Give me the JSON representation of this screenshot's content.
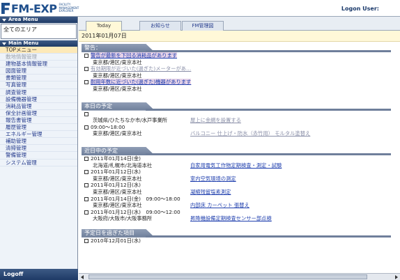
{
  "app": {
    "logo_text": "FM-EXP",
    "logo_sub": "FACILITY MANAGEMENT EXPLORER",
    "logon_label": "Logon User:"
  },
  "sidebar": {
    "area_menu_title": "Area Menu",
    "area_value": "全てのエリア",
    "main_menu_title": "Main Menu",
    "items": [
      {
        "label": "TOPメニュー",
        "state": "active"
      },
      {
        "label": "敷地情報管理",
        "state": "disabled"
      },
      {
        "label": "建物基本情報管理",
        "state": "normal"
      },
      {
        "label": "図面管理",
        "state": "normal"
      },
      {
        "label": "書類管理",
        "state": "normal"
      },
      {
        "label": "写真管理",
        "state": "normal"
      },
      {
        "label": "調査管理",
        "state": "normal"
      },
      {
        "label": "設備機器管理",
        "state": "normal"
      },
      {
        "label": "消耗品管理",
        "state": "normal"
      },
      {
        "label": "保全計画管理",
        "state": "normal"
      },
      {
        "label": "報告書管理",
        "state": "normal"
      },
      {
        "label": "履歴管理",
        "state": "normal"
      },
      {
        "label": "エネルギー管理",
        "state": "normal"
      },
      {
        "label": "補助管理",
        "state": "normal"
      },
      {
        "label": "清掃管理",
        "state": "normal"
      },
      {
        "label": "警備管理",
        "state": "normal"
      },
      {
        "label": "システム管理",
        "state": "normal"
      }
    ],
    "logoff_label": "Logoff"
  },
  "tabs": [
    {
      "label": "Today"
    },
    {
      "label": "お知らせ"
    },
    {
      "label": "FM管理図"
    }
  ],
  "date": "2011年01月07日",
  "sections": {
    "warning": {
      "title": "警告：",
      "rows": [
        {
          "text": "警告が最新を下回る消耗品があります",
          "style": "hl-link",
          "icon": true
        },
        {
          "text": "東京都/港区/東京本社",
          "style": "plain"
        },
        {
          "text": "有効期限が近づいた(過ぎた)メーターがあ…",
          "style": "muted-link",
          "icon": true
        },
        {
          "text": "東京都/港区/東京本社",
          "style": "plain"
        },
        {
          "text": "耐用年数に近づいた(過ぎた)機器があります",
          "style": "hl-link",
          "icon": true
        },
        {
          "text": "東京都/港区/東京本社",
          "style": "plain"
        }
      ]
    },
    "today": {
      "title": "本日の予定",
      "rows": [
        {
          "left": "",
          "right": ""
        },
        {
          "left": "茨城県/ひたちなか市/水戸事業所",
          "right": "屋上に金網を設置する"
        },
        {
          "left": "09:00～18:00",
          "right": ""
        },
        {
          "left": "東京都/港区/東京本社",
          "right": "バルコニー 仕上げ・防水（赤竹用） モルタル塗替え"
        }
      ]
    },
    "upcoming": {
      "title": "近日中の予定",
      "rows": [
        {
          "left": "2011年01月14日(金)",
          "right": ""
        },
        {
          "left": "北海道/札幌市/北海道本社",
          "right": "自家用電気工作物定期検査・測定・試験"
        },
        {
          "left": "2011年01月12日(水)",
          "right": ""
        },
        {
          "left": "東京都/港区/東京本社",
          "right": "室内空気環境の測定"
        },
        {
          "left": "2011年01月12日(水)",
          "right": ""
        },
        {
          "left": "東京都/港区/東京本社",
          "right": "凝縮残留塩素測定"
        },
        {
          "left": "2011年01月14日(金)　09:00～18:00",
          "right": ""
        },
        {
          "left": "東京都/港区/東京本社",
          "right": "内部床 カーペット 張替え"
        },
        {
          "left": "2011年01月12日(水)　09:00～12:00",
          "right": ""
        },
        {
          "left": "大阪府/大阪市/大阪事務所",
          "right": "昇降機設備定期検査センサー部点検"
        }
      ]
    },
    "overdue": {
      "title": "予定日を過ぎた項目",
      "rows": [
        {
          "left": "2010年12月01日(水)"
        }
      ]
    }
  },
  "colors": {
    "header_dark": "#1e3a66",
    "link": "#1f3fae",
    "date_bar": "#fff8d8"
  }
}
